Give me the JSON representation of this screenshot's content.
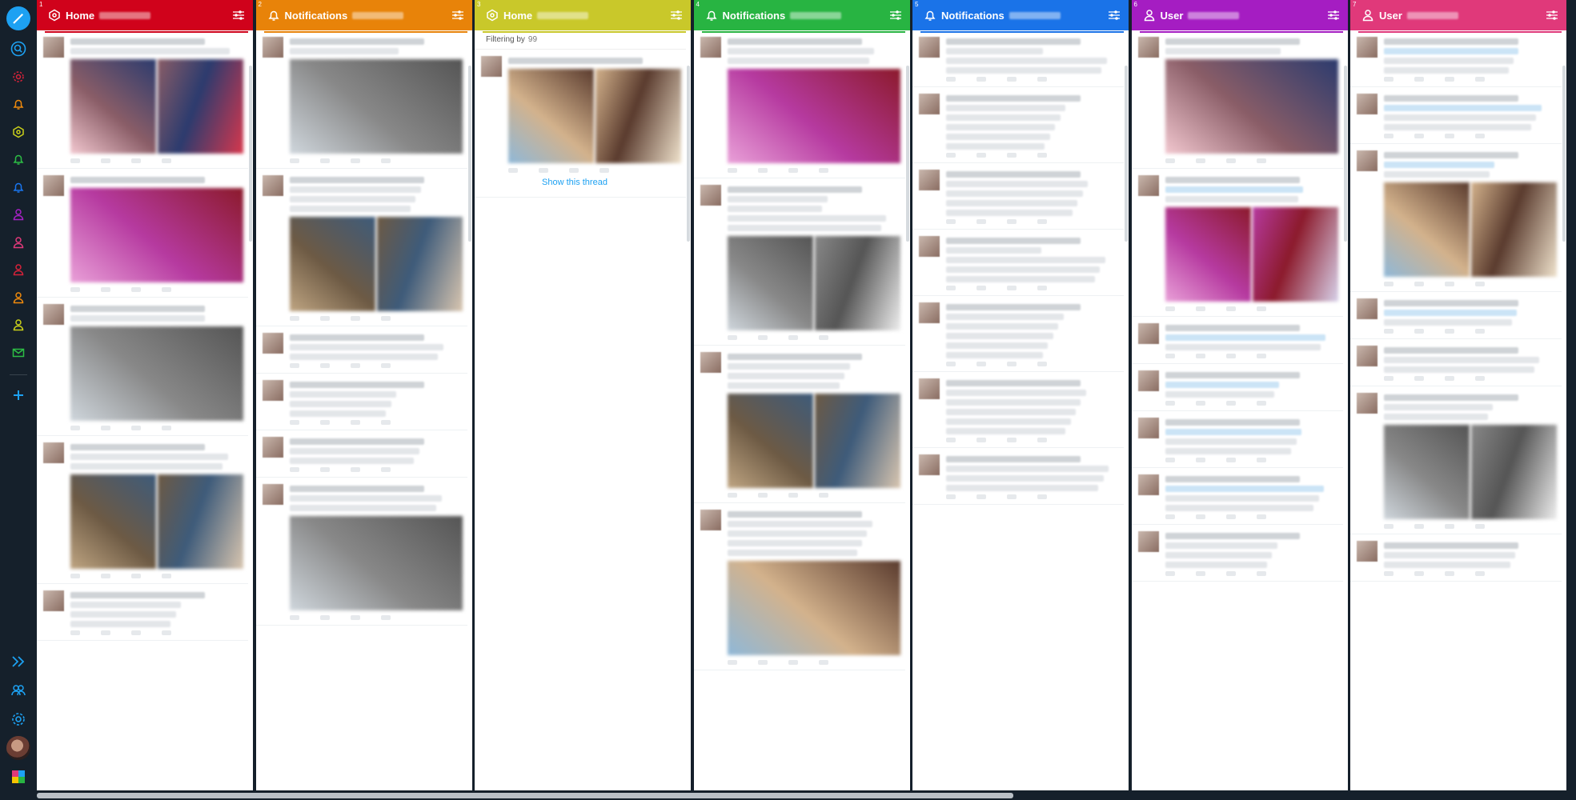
{
  "sidebar": {
    "top_icons": [
      {
        "name": "search-icon",
        "color": "#1da1f2"
      },
      {
        "name": "settings-gear-icon",
        "color": "#d6223a"
      },
      {
        "name": "bell-icon",
        "color": "#f08a0c"
      },
      {
        "name": "home-icon",
        "color": "#cbd11a"
      },
      {
        "name": "bell-icon",
        "color": "#2dbd45"
      },
      {
        "name": "bell-icon",
        "color": "#1976f0"
      },
      {
        "name": "user-icon",
        "color": "#a621c5"
      },
      {
        "name": "user-icon",
        "color": "#e0397a"
      },
      {
        "name": "user-icon",
        "color": "#d6223a"
      },
      {
        "name": "user-icon",
        "color": "#f08a0c"
      },
      {
        "name": "user-icon",
        "color": "#cbd11a"
      },
      {
        "name": "mail-icon",
        "color": "#2dbd45"
      }
    ],
    "add_column_icon": "plus-icon",
    "bottom_icons": [
      "expand-icon",
      "accounts-icon",
      "settings-icon"
    ]
  },
  "columns": [
    {
      "index": "1",
      "title": "Home",
      "icon": "home-icon",
      "color": "#d0021b",
      "accent": "#d0021b"
    },
    {
      "index": "2",
      "title": "Notifications",
      "icon": "bell-icon",
      "color": "#e88309",
      "accent": "#e88309"
    },
    {
      "index": "3",
      "title": "Home",
      "icon": "home-icon",
      "color": "#c9c82a",
      "accent": "#c9c82a",
      "filter_label": "Filtering by",
      "filter_value": "99",
      "show_thread": "Show this thread"
    },
    {
      "index": "4",
      "title": "Notifications",
      "icon": "bell-icon",
      "color": "#28b442",
      "accent": "#28b442"
    },
    {
      "index": "5",
      "title": "Notifications",
      "icon": "bell-icon",
      "color": "#1a73e8",
      "accent": "#1a73e8"
    },
    {
      "index": "6",
      "title": "User",
      "icon": "user-icon",
      "color": "#a51dc2",
      "accent": "#a51dc2"
    },
    {
      "index": "7",
      "title": "User",
      "icon": "user-icon",
      "color": "#e0397a",
      "accent": "#e0397a"
    }
  ]
}
